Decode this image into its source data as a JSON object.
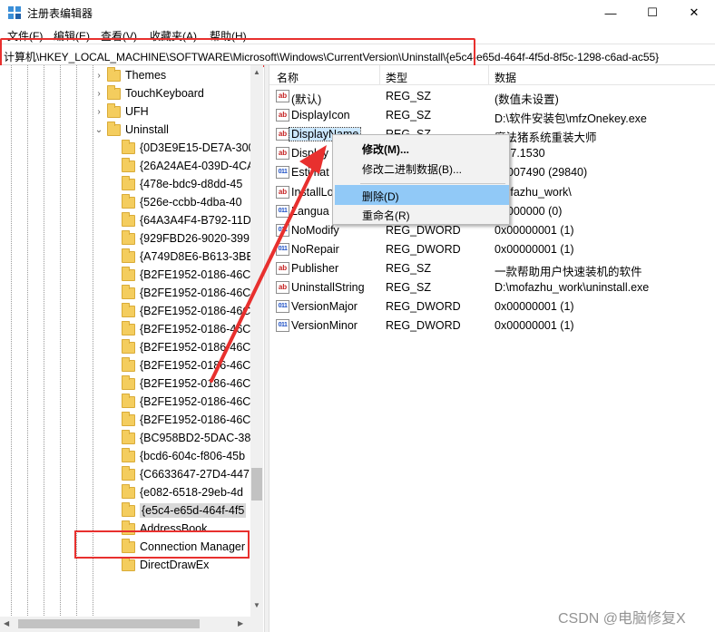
{
  "window": {
    "title": "注册表编辑器",
    "min_glyph": "—",
    "max_glyph": "☐",
    "close_glyph": "✕"
  },
  "menu": [
    "文件(F)",
    "编辑(E)",
    "查看(V)",
    "收藏夹(A)",
    "帮助(H)"
  ],
  "address": "计算机\\HKEY_LOCAL_MACHINE\\SOFTWARE\\Microsoft\\Windows\\CurrentVersion\\Uninstall\\{e5c4-e65d-464f-4f5d-8f5c-1298-c6ad-ac55}",
  "tree": {
    "top_items": [
      {
        "label": "Themes",
        "expander": "›"
      },
      {
        "label": "TouchKeyboard",
        "expander": "›"
      },
      {
        "label": "UFH",
        "expander": "›"
      },
      {
        "label": "Uninstall",
        "expander": "⌄"
      }
    ],
    "uninstall_children": [
      "{0D3E9E15-DE7A-300",
      "{26A24AE4-039D-4CA",
      "{478e-bdc9-d8dd-45",
      "{526e-ccbb-4dba-40",
      "{64A3A4F4-B792-11D",
      "{929FBD26-9020-399",
      "{A749D8E6-B613-3BE",
      "{B2FE1952-0186-46C",
      "{B2FE1952-0186-46C",
      "{B2FE1952-0186-46C",
      "{B2FE1952-0186-46C",
      "{B2FE1952-0186-46C",
      "{B2FE1952-0186-46C",
      "{B2FE1952-0186-46C",
      "{B2FE1952-0186-46C",
      "{B2FE1952-0186-46C",
      "{BC958BD2-5DAC-38",
      "{bcd6-604c-f806-45b",
      "{C6633647-27D4-447",
      "{e082-6518-29eb-4d",
      "{e5c4-e65d-464f-4f5",
      "AddressBook",
      "Connection Manager",
      "DirectDrawEx"
    ],
    "selected_index": 20
  },
  "list": {
    "columns": [
      "名称",
      "类型",
      "数据"
    ],
    "rows": [
      {
        "icon": "ab",
        "name": "(默认)",
        "type": "REG_SZ",
        "data": "(数值未设置)"
      },
      {
        "icon": "ab",
        "name": "DisplayIcon",
        "type": "REG_SZ",
        "data": "D:\\软件安装包\\mfzOnekey.exe"
      },
      {
        "icon": "ab",
        "name": "DisplayName",
        "type": "REG_SZ",
        "data": "魔法猪系统重装大师"
      },
      {
        "icon": "ab",
        "name": "Display",
        "type": "REG_SZ",
        "data": "5.47.1530"
      },
      {
        "icon": "bin",
        "name": "Estimat",
        "type": "REG_DWORD",
        "data": "00007490 (29840)"
      },
      {
        "icon": "ab",
        "name": "InstallLo",
        "type": "REG_SZ",
        "data": "mofazhu_work\\"
      },
      {
        "icon": "bin",
        "name": "Langua",
        "type": "REG_DWORD",
        "data": "00000000 (0)"
      },
      {
        "icon": "bin",
        "name": "NoModify",
        "type": "REG_DWORD",
        "data": "0x00000001 (1)"
      },
      {
        "icon": "bin",
        "name": "NoRepair",
        "type": "REG_DWORD",
        "data": "0x00000001 (1)"
      },
      {
        "icon": "ab",
        "name": "Publisher",
        "type": "REG_SZ",
        "data": "一款帮助用户快速装机的软件"
      },
      {
        "icon": "ab",
        "name": "UninstallString",
        "type": "REG_SZ",
        "data": "D:\\mofazhu_work\\uninstall.exe"
      },
      {
        "icon": "bin",
        "name": "VersionMajor",
        "type": "REG_DWORD",
        "data": "0x00000001 (1)"
      },
      {
        "icon": "bin",
        "name": "VersionMinor",
        "type": "REG_DWORD",
        "data": "0x00000001 (1)"
      }
    ],
    "selected_index": 2
  },
  "context_menu": {
    "items": [
      "修改(M)...",
      "修改二进制数据(B)...",
      "删除(D)",
      "重命名(R)"
    ],
    "hot_index": 2
  },
  "watermark": "CSDN @电脑修复X",
  "colors": {
    "highlight_box": "#e8302e",
    "arrow": "#e8302e",
    "menu_hot": "#91c9f7"
  }
}
